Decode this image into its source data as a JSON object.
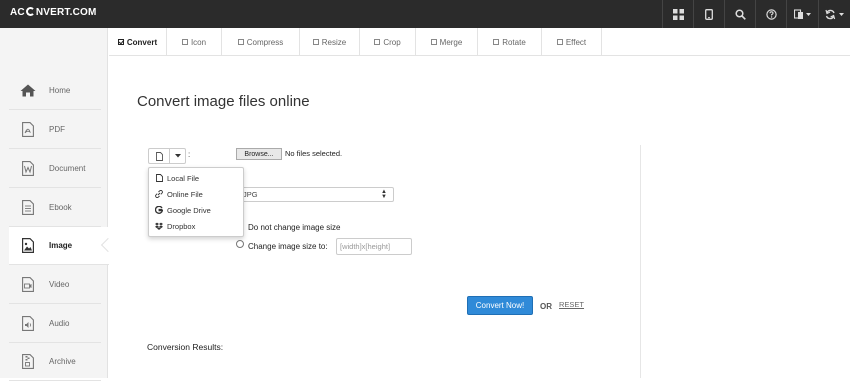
{
  "logo": {
    "text_before": "AC",
    "text_after": "NVERT.COM"
  },
  "topbar": {
    "icons": [
      "grid-icon",
      "mobile-icon",
      "search-icon",
      "help-icon",
      "language-icon",
      "refresh-icon"
    ]
  },
  "sidebar": {
    "items": [
      {
        "label": "Home",
        "icon": "home-icon"
      },
      {
        "label": "PDF",
        "icon": "pdf-icon"
      },
      {
        "label": "Document",
        "icon": "document-icon"
      },
      {
        "label": "Ebook",
        "icon": "ebook-icon"
      },
      {
        "label": "Image",
        "icon": "image-icon",
        "active": true
      },
      {
        "label": "Video",
        "icon": "video-icon"
      },
      {
        "label": "Audio",
        "icon": "audio-icon"
      },
      {
        "label": "Archive",
        "icon": "archive-icon"
      }
    ]
  },
  "tabs": [
    {
      "label": "Convert",
      "active": true
    },
    {
      "label": "Icon"
    },
    {
      "label": "Compress"
    },
    {
      "label": "Resize"
    },
    {
      "label": "Crop"
    },
    {
      "label": "Merge"
    },
    {
      "label": "Rotate"
    },
    {
      "label": "Effect"
    }
  ],
  "main": {
    "title": "Convert image files online",
    "colon": ":",
    "browse_label": "Browse...",
    "no_file_text": "No files selected.",
    "source_menu": [
      {
        "label": "Local File",
        "icon": "file-icon"
      },
      {
        "label": "Online File",
        "icon": "link-icon"
      },
      {
        "label": "Google Drive",
        "icon": "google-icon"
      },
      {
        "label": "Dropbox",
        "icon": "dropbox-icon"
      }
    ],
    "format_select_value": "JPG",
    "radio_keep_label": "Do not change image size",
    "radio_change_label": "Change image size to:",
    "size_placeholder": "[width]x[height]",
    "convert_button": "Convert Now!",
    "or_text": "OR",
    "reset_text": "RESET",
    "results_label": "Conversion Results:"
  },
  "colors": {
    "topbar": "#2b2b2b",
    "accent": "#2f8ad8",
    "sidebar_bg": "#f4f4f4"
  }
}
